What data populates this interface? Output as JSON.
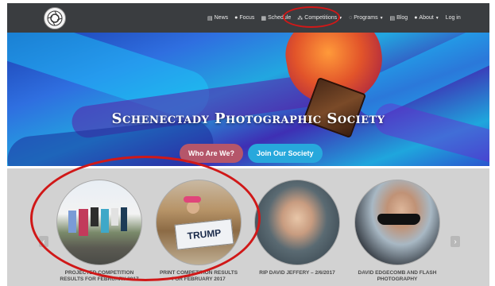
{
  "nav": {
    "items": [
      {
        "icon": "newspaper-icon",
        "label": "News",
        "glyph": "▤"
      },
      {
        "icon": "info-circle-icon",
        "label": "Focus",
        "glyph": "●"
      },
      {
        "icon": "calendar-icon",
        "label": "Schedule",
        "glyph": "▦"
      },
      {
        "icon": "sitemap-icon",
        "label": "Competitions",
        "glyph": "⁂",
        "dropdown": true
      },
      {
        "icon": "globe-icon",
        "label": "Programs",
        "glyph": "◌",
        "dropdown": true
      },
      {
        "icon": "blog-icon",
        "label": "Blog",
        "glyph": "▤"
      },
      {
        "icon": "info-icon",
        "label": "About",
        "glyph": "●",
        "dropdown": true
      },
      {
        "icon": "",
        "label": "Log in",
        "glyph": ""
      }
    ]
  },
  "hero": {
    "title": "Schenectady Photographic Society",
    "who_button": "Who Are We?",
    "join_button": "Join Our Society"
  },
  "carousel": {
    "prev_glyph": "‹",
    "next_glyph": "›",
    "slides": [
      {
        "caption_line1": "Projected Competition",
        "caption_line2": "Results for February 2017"
      },
      {
        "caption_line1": "Print Competition Results",
        "caption_line2": "for February 2017",
        "sign_text": "TRUMP"
      },
      {
        "caption_line1": "RIP David Jeffery – 2/6/2017",
        "caption_line2": ""
      },
      {
        "caption_line1": "David Edgecomb and Flash",
        "caption_line2": "Photography"
      }
    ]
  },
  "colors": {
    "nav_bg": "#3a3d40",
    "who_button_bg": "#b5566a",
    "join_button_bg": "#27a8dc",
    "annotation_red": "#d01818",
    "carousel_bg": "#d2d2d2"
  }
}
